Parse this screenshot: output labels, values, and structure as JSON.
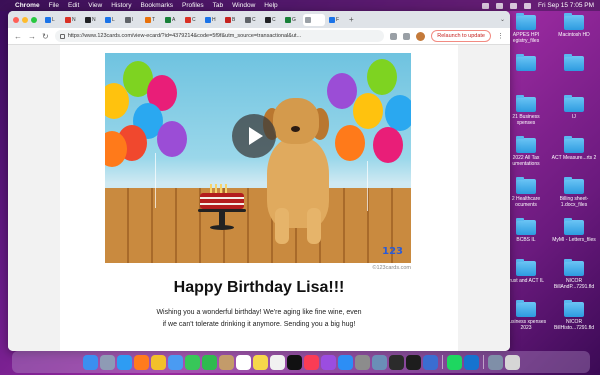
{
  "menubar": {
    "app": "Chrome",
    "items": [
      "File",
      "Edit",
      "View",
      "History",
      "Bookmarks",
      "Profiles",
      "Tab",
      "Window",
      "Help"
    ],
    "clock": "Fri Sep 15  7:05 PM"
  },
  "browser": {
    "tabs": [
      {
        "label": "L",
        "color": "#1a73e8"
      },
      {
        "label": "N",
        "color": "#d93025"
      },
      {
        "label": "N",
        "color": "#202124"
      },
      {
        "label": "L",
        "color": "#1a73e8"
      },
      {
        "label": "l",
        "color": "#5f6368"
      },
      {
        "label": "T",
        "color": "#e8710a"
      },
      {
        "label": "A",
        "color": "#188038"
      },
      {
        "label": "C",
        "color": "#d93025"
      },
      {
        "label": "H",
        "color": "#1a73e8"
      },
      {
        "label": "B",
        "color": "#c5221f"
      },
      {
        "label": "C",
        "color": "#5f6368"
      },
      {
        "label": "C",
        "color": "#202124"
      },
      {
        "label": "G",
        "color": "#188038"
      },
      {
        "label": "",
        "color": "#9aa0a6"
      },
      {
        "label": "F",
        "color": "#1a73e8"
      }
    ],
    "new_tab": "+",
    "url": "https://www.123cards.com/view-ecard/?id=4379214&code=5f9f&utm_source=transactional&ut...",
    "relaunch_label": "Relaunch to update"
  },
  "ecard": {
    "copyright": "©123cards.com",
    "heading": "Happy Birthday Lisa!!!",
    "message": "Wishing you a wonderful birthday! We're aging like fine wine, even if we can't tolerate drinking it anymore. Sending you a big hug!",
    "logo": "123"
  },
  "desktop": {
    "icons": [
      {
        "label": "APPES HPI egistry_files"
      },
      {
        "label": "Macintosh HD"
      },
      {
        "label": ""
      },
      {
        "label": ""
      },
      {
        "label": "21 Business xpenses"
      },
      {
        "label": "IJ"
      },
      {
        "label": "2022 All Tax umentations"
      },
      {
        "label": "ACT Measure...rts 2"
      },
      {
        "label": "2 Healthcare ocuments"
      },
      {
        "label": "Billing sheet-1.docx_files"
      },
      {
        "label": "BCBS IL"
      },
      {
        "label": "MyMI - Letters_files"
      },
      {
        "label": "trust and ACT IL"
      },
      {
        "label": "NICOR BillAndP...7291.fld"
      },
      {
        "label": "Business xpenses 2023"
      },
      {
        "label": "NICOR BillHisto...7291.fld"
      }
    ]
  },
  "dock": {
    "apps": [
      {
        "name": "finder",
        "color": "#3b8ff0"
      },
      {
        "name": "launchpad",
        "color": "#8e9bb5"
      },
      {
        "name": "safari",
        "color": "#2e9cf3"
      },
      {
        "name": "firefox",
        "color": "#ff7b1c"
      },
      {
        "name": "chrome",
        "color": "#f2c02a"
      },
      {
        "name": "mail",
        "color": "#4a9bf2"
      },
      {
        "name": "messages",
        "color": "#38c759"
      },
      {
        "name": "facetime",
        "color": "#2fba4f"
      },
      {
        "name": "contacts",
        "color": "#c39b6a"
      },
      {
        "name": "calendar",
        "color": "#ffffff"
      },
      {
        "name": "notes",
        "color": "#f6d64b"
      },
      {
        "name": "photos",
        "color": "#f1f1f1"
      },
      {
        "name": "appletv",
        "color": "#111111"
      },
      {
        "name": "music",
        "color": "#fa3c55"
      },
      {
        "name": "podcasts",
        "color": "#9b4de0"
      },
      {
        "name": "appstore",
        "color": "#2c8ef5"
      },
      {
        "name": "settings",
        "color": "#8c8c8c"
      },
      {
        "name": "preview",
        "color": "#6a8fb7"
      },
      {
        "name": "activity",
        "color": "#2b2b2b"
      },
      {
        "name": "terminal",
        "color": "#1d1d1d"
      },
      {
        "name": "word",
        "color": "#3a6dd1"
      },
      {
        "name": "spotify",
        "color": "#1ed760"
      },
      {
        "name": "outlook",
        "color": "#1673cf"
      },
      {
        "name": "downloads",
        "color": "#7f8fa8"
      },
      {
        "name": "trash",
        "color": "#d6d6d6"
      }
    ]
  }
}
